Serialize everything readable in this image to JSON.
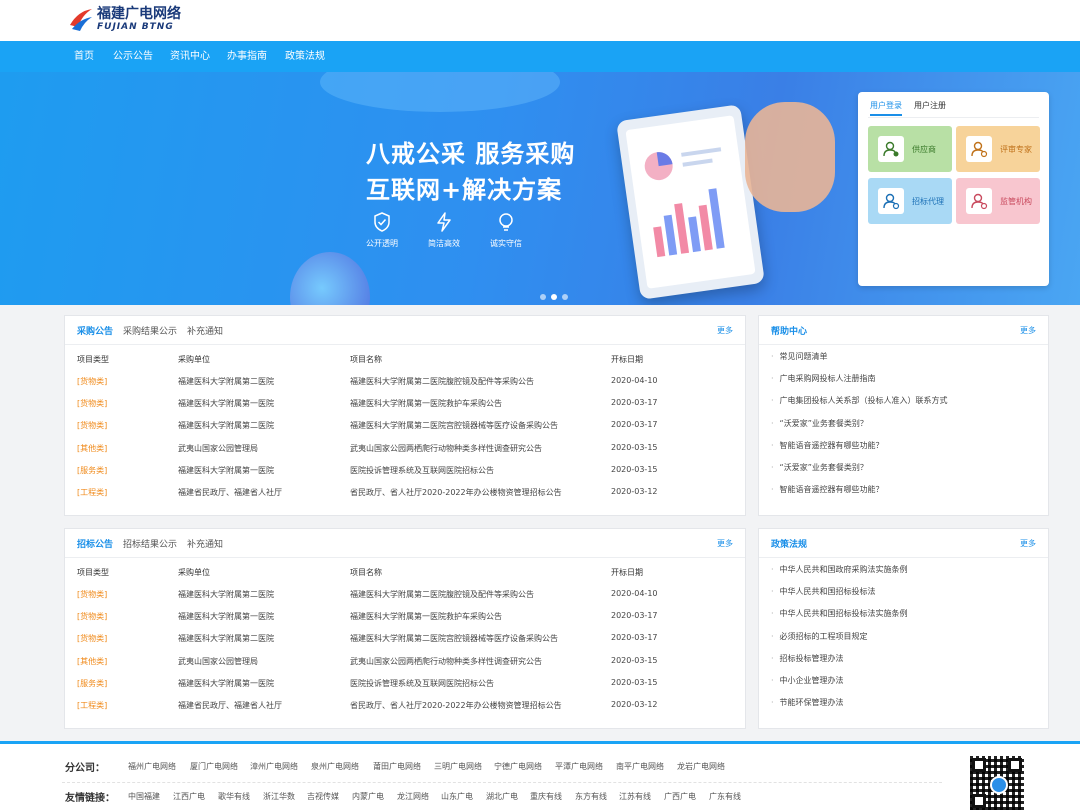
{
  "header": {
    "logo_cn": "福建广电网络",
    "logo_en": "FUJIAN BTNG",
    "nav": [
      "首页",
      "公示公告",
      "资讯中心",
      "办事指南",
      "政策法规"
    ]
  },
  "banner": {
    "line1": "八戒公采 服务采购",
    "line2": "互联网+解决方案",
    "features": [
      {
        "label": "公开透明",
        "icon": "shield-check-icon"
      },
      {
        "label": "简洁高效",
        "icon": "lightning-icon"
      },
      {
        "label": "诚实守信",
        "icon": "lightbulb-icon"
      }
    ],
    "slide_count": 3,
    "active_slide": 2
  },
  "login": {
    "tabs": [
      "用户登录",
      "用户注册"
    ],
    "roles": [
      {
        "label": "供应商",
        "color": "#b8e0a5",
        "text_color": "#3a7a2a",
        "icon": "supplier-icon"
      },
      {
        "label": "评审专家",
        "color": "#f7d39a",
        "text_color": "#c0721a",
        "icon": "expert-icon"
      },
      {
        "label": "招标代理",
        "color": "#a9d9f5",
        "text_color": "#1a6fb5",
        "icon": "agent-icon"
      },
      {
        "label": "监管机构",
        "color": "#f8c6cf",
        "text_color": "#c94a5e",
        "icon": "regulator-icon"
      }
    ]
  },
  "procurement": {
    "tabs": [
      "采购公告",
      "采购结果公示",
      "补充通知"
    ],
    "more": "更多",
    "headers": [
      "项目类型",
      "采购单位",
      "项目名称",
      "开标日期"
    ],
    "rows": [
      [
        "[货物类]",
        "福建医科大学附属第二医院",
        "福建医科大学附属第二医院腹腔镜及配件等采购公告",
        "2020-04-10"
      ],
      [
        "[货物类]",
        "福建医科大学附属第一医院",
        "福建医科大学附属第一医院救护车采购公告",
        "2020-03-17"
      ],
      [
        "[货物类]",
        "福建医科大学附属第二医院",
        "福建医科大学附属第二医院宫腔镜器械等医疗设备采购公告",
        "2020-03-17"
      ],
      [
        "[其他类]",
        "武夷山国家公园管理局",
        "武夷山国家公园两栖爬行动物种类多样性调查研究公告",
        "2020-03-15"
      ],
      [
        "[服务类]",
        "福建医科大学附属第一医院",
        "医院投诉管理系统及互联网医院招标公告",
        "2020-03-15"
      ],
      [
        "[工程类]",
        "福建省民政厅、福建省人社厅",
        "省民政厅、省人社厅2020-2022年办公楼物资管理招标公告",
        "2020-03-12"
      ]
    ]
  },
  "bidding": {
    "tabs": [
      "招标公告",
      "招标结果公示",
      "补充通知"
    ],
    "more": "更多",
    "headers": [
      "项目类型",
      "采购单位",
      "项目名称",
      "开标日期"
    ],
    "rows": [
      [
        "[货物类]",
        "福建医科大学附属第二医院",
        "福建医科大学附属第二医院腹腔镜及配件等采购公告",
        "2020-04-10"
      ],
      [
        "[货物类]",
        "福建医科大学附属第一医院",
        "福建医科大学附属第一医院救护车采购公告",
        "2020-03-17"
      ],
      [
        "[货物类]",
        "福建医科大学附属第二医院",
        "福建医科大学附属第二医院宫腔镜器械等医疗设备采购公告",
        "2020-03-17"
      ],
      [
        "[其他类]",
        "武夷山国家公园管理局",
        "武夷山国家公园两栖爬行动物种类多样性调查研究公告",
        "2020-03-15"
      ],
      [
        "[服务类]",
        "福建医科大学附属第一医院",
        "医院投诉管理系统及互联网医院招标公告",
        "2020-03-15"
      ],
      [
        "[工程类]",
        "福建省民政厅、福建省人社厅",
        "省民政厅、省人社厅2020-2022年办公楼物资管理招标公告",
        "2020-03-12"
      ]
    ]
  },
  "help": {
    "title": "帮助中心",
    "more": "更多",
    "items": [
      "常见问题清单",
      "广电采购网投标人注册指南",
      "广电集团投标人关系部（投标人准入）联系方式",
      "“沃爱家”业务套餐类别？",
      "智能语音遥控器有哪些功能？",
      "“沃爱家”业务套餐类别？",
      "智能语音遥控器有哪些功能？"
    ]
  },
  "policy": {
    "title": "政策法规",
    "more": "更多",
    "items": [
      "中华人民共和国政府采购法实施条例",
      "中华人民共和国招标投标法",
      "中华人民共和国招标投标法实施条例",
      "必须招标的工程项目规定",
      "招标投标管理办法",
      "中小企业管理办法",
      "节能环保管理办法"
    ]
  },
  "footer": {
    "branches_label": "分公司：",
    "branches": [
      "福州广电网络",
      "厦门广电网络",
      "漳州广电网络",
      "泉州广电网络",
      "莆田广电网络",
      "三明广电网络",
      "宁德广电网络",
      "平潭广电网络",
      "南平广电网络",
      "龙岩广电网络"
    ],
    "links_label": "友情链接：",
    "links": [
      "中国福建",
      "江西广电",
      "歌华有线",
      "浙江华数",
      "吉视传媒",
      "内蒙广电",
      "龙江网络",
      "山东广电",
      "湖北广电",
      "重庆有线",
      "东方有线",
      "江苏有线",
      "广西广电",
      "广东有线"
    ]
  }
}
